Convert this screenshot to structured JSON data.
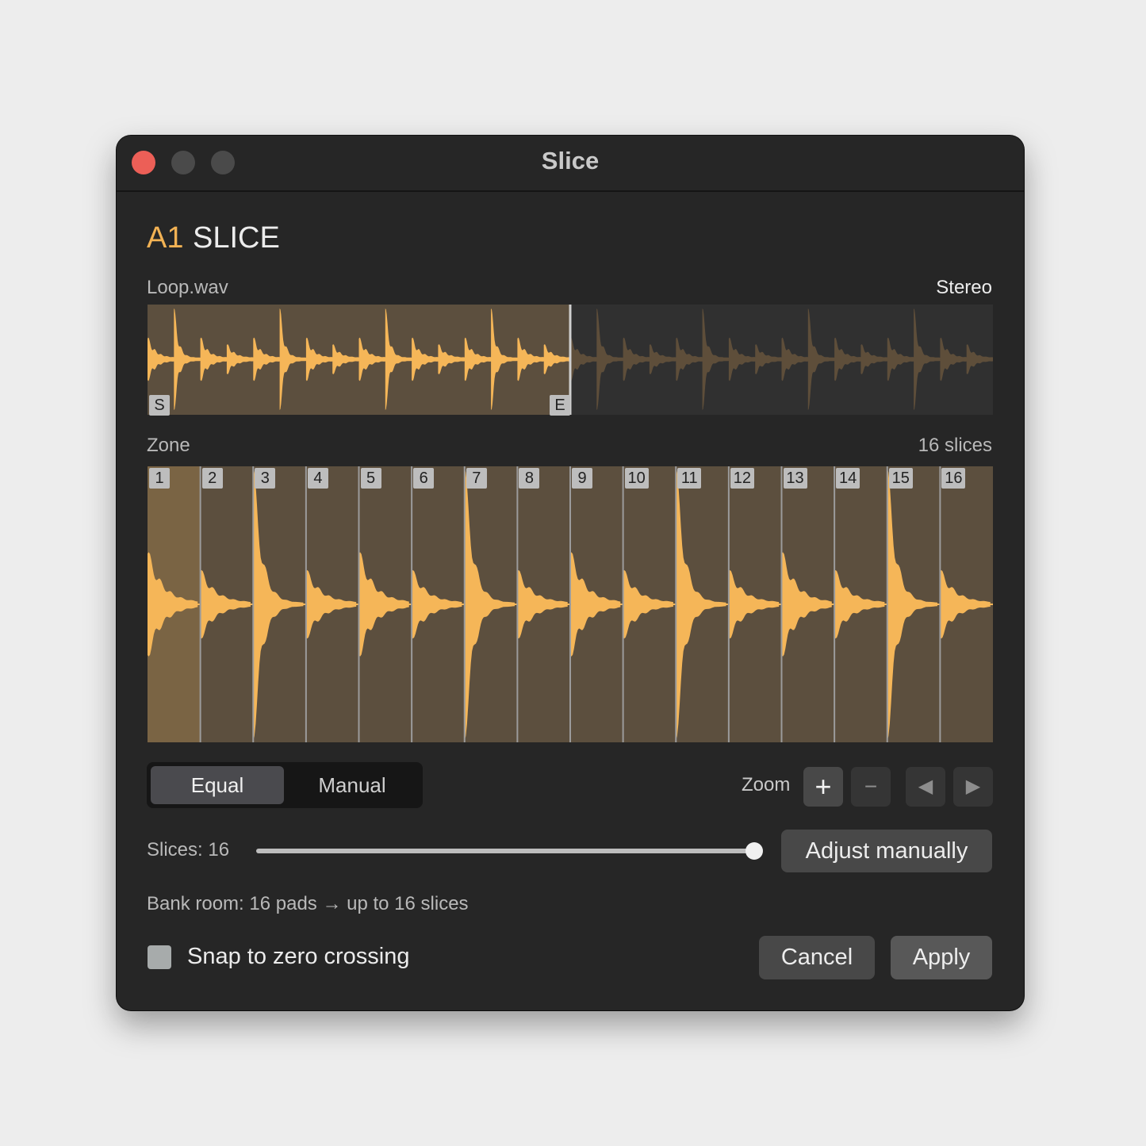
{
  "window": {
    "title": "Slice"
  },
  "header": {
    "pad_id": "A1",
    "mode": "SLICE"
  },
  "overview": {
    "file_name": "Loop.wav",
    "channel": "Stereo",
    "start_marker": "S",
    "end_marker": "E",
    "selection_fraction": 0.5
  },
  "zone": {
    "label": "Zone",
    "count_label": "16 slices",
    "slices": [
      "1",
      "2",
      "3",
      "4",
      "5",
      "6",
      "7",
      "8",
      "9",
      "10",
      "11",
      "12",
      "13",
      "14",
      "15",
      "16"
    ],
    "selected_slice": "1"
  },
  "mode": {
    "equal_label": "Equal",
    "manual_label": "Manual",
    "active": "Equal"
  },
  "zoom": {
    "label": "Zoom",
    "in_symbol": "+",
    "out_symbol": "−",
    "left_symbol": "◀",
    "right_symbol": "▶"
  },
  "slices_control": {
    "label": "Slices: 16",
    "value": 16,
    "max": 16
  },
  "adjust_button": "Adjust manually",
  "bank_info": "Bank room: 16 pads → up to 16 slices",
  "snap": {
    "label": "Snap to zero crossing",
    "checked": false
  },
  "actions": {
    "cancel": "Cancel",
    "apply": "Apply"
  },
  "colors": {
    "accent": "#f5b658",
    "selection_bg": "#5c4f3e",
    "selected_slice_bg": "#7a6444",
    "dim_wave": "#5e4e3a",
    "close": "#ec5f57"
  },
  "icons": [
    "close-dot",
    "minimize-dot",
    "maximize-dot",
    "plus-icon",
    "minus-icon",
    "arrow-left-icon",
    "arrow-right-icon",
    "checkbox"
  ]
}
